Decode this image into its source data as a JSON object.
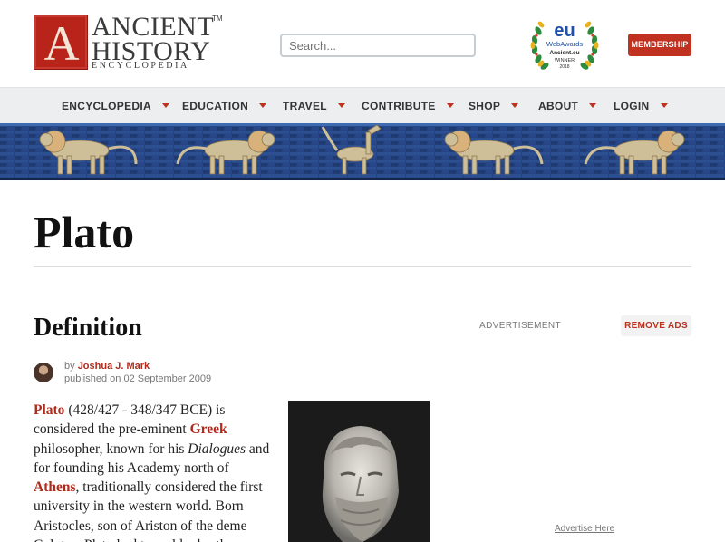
{
  "header": {
    "logo": {
      "letter": "A",
      "line1": "ANCIENT",
      "line2": "HISTORY",
      "line3": "ENCYCLOPEDIA",
      "tm": "TM"
    },
    "search_placeholder": "Search...",
    "award": {
      "top": "eu",
      "line1": "WebAwards",
      "line2": "Ancient.eu",
      "line3": "WINNER",
      "year": "2018"
    },
    "membership_label": "MEMBERSHIP"
  },
  "nav": {
    "items": [
      {
        "label": "ENCYCLOPEDIA"
      },
      {
        "label": "EDUCATION"
      },
      {
        "label": "TRAVEL"
      },
      {
        "label": "CONTRIBUTE"
      },
      {
        "label": "SHOP"
      },
      {
        "label": "ABOUT"
      },
      {
        "label": "LOGIN"
      }
    ]
  },
  "page": {
    "title": "Plato",
    "section_heading": "Definition",
    "advertisement_label": "ADVERTISEMENT",
    "remove_ads_label": "REMOVE ADS",
    "advertise_here": "Advertise Here"
  },
  "byline": {
    "by": "by",
    "author": "Joshua J. Mark",
    "published_prefix": "published on",
    "date": "02 September 2009"
  },
  "article": {
    "link_plato": "Plato",
    "t1": " (428/427 - 348/347 BCE) is considered the pre-eminent ",
    "link_greek": "Greek",
    "t2": " philosopher, known for his ",
    "dialogues": "Dialogues",
    "t3": " and for founding his Academy north of ",
    "link_athens": "Athens",
    "t4": ", traditionally considered the first university in the western world. Born Aristocles, son of Ariston of the deme Colytus, Plato had two older brothers"
  },
  "colors": {
    "brand_red": "#c0321f",
    "link_red": "#b02a1b",
    "nav_bg": "#eceeef",
    "banner_blue": "#22407a"
  }
}
